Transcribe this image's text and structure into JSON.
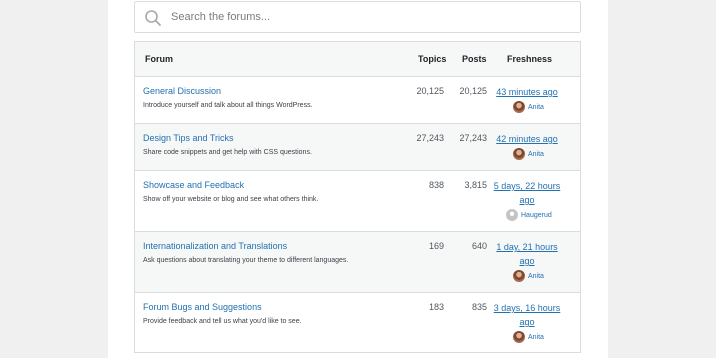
{
  "search": {
    "placeholder": "Search the forums..."
  },
  "table": {
    "headers": {
      "forum": "Forum",
      "topics": "Topics",
      "posts": "Posts",
      "freshness": "Freshness"
    },
    "rows": [
      {
        "title": "General Discussion",
        "description": "Introduce yourself and talk about all things WordPress.",
        "topics": "20,125",
        "posts": "20,125",
        "freshness_line1": "43 minutes ago",
        "freshness_line2": "",
        "author": "Anita",
        "avatar": "photo-avatar"
      },
      {
        "title": "Design Tips and Tricks",
        "description": "Share code snippets and get help with CSS questions.",
        "topics": "27,243",
        "posts": "27,243",
        "freshness_line1": "42 minutes ago",
        "freshness_line2": "",
        "author": "Anita",
        "avatar": "photo-avatar"
      },
      {
        "title": "Showcase and Feedback",
        "description": "Show off your website or blog and see what others think.",
        "topics": "838",
        "posts": "3,815",
        "freshness_line1": "5 days, 22 hours",
        "freshness_line2": "ago",
        "author": "Haugerud",
        "avatar": "default-avatar"
      },
      {
        "title": "Internationalization and Translations",
        "description": "Ask questions about translating your theme to different languages.",
        "topics": "169",
        "posts": "640",
        "freshness_line1": "1 day, 21 hours",
        "freshness_line2": "ago",
        "author": "Anita",
        "avatar": "photo-avatar"
      },
      {
        "title": "Forum Bugs and Suggestions",
        "description": "Provide feedback and tell us what you'd like to see.",
        "topics": "183",
        "posts": "835",
        "freshness_line1": "3 days, 16 hours",
        "freshness_line2": "ago",
        "author": "Anita",
        "avatar": "photo-avatar"
      }
    ]
  },
  "colors": {
    "link": "#2271b1",
    "border": "#dcdcde",
    "alt_row": "#f6f7f7"
  }
}
